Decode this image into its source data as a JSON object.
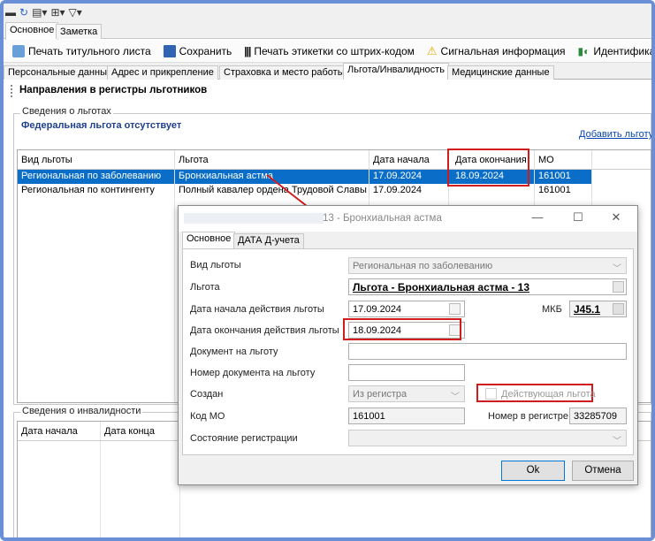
{
  "main_tabs": [
    "Основное",
    "Заметка"
  ],
  "toolbar": {
    "print_title": "Печать титульного листа",
    "save": "Сохранить",
    "print_labels": "Печать этикетки со штрих-кодом",
    "signal_info": "Сигнальная информация",
    "identification": "Идентификация"
  },
  "sub_tabs": [
    "Персональные данные",
    "Адрес и прикрепление",
    "Страховка и место работы",
    "Льгота/Инвалидность",
    "Медицинские данные"
  ],
  "section_title": "Направления в регистры льготников",
  "benefits_group": {
    "label": "Сведения о льготах",
    "federal_status": "Федеральная льгота отсутствует",
    "add_link": "Добавить льготу"
  },
  "benefits_table": {
    "headers": [
      "Вид льготы",
      "Льгота",
      "Дата начала",
      "Дата окончания",
      "МО"
    ],
    "rows": [
      [
        "Региональная по заболеванию",
        "Бронхиальная астма",
        "17.09.2024",
        "18.09.2024",
        "161001"
      ],
      [
        "Региональная по контингенту",
        "Полный кавалер ордена Трудовой Славы",
        "17.09.2024",
        "",
        "161001"
      ]
    ]
  },
  "disability_group": {
    "label": "Сведения о инвалидности",
    "headers": [
      "Дата начала",
      "Дата конца"
    ]
  },
  "dialog": {
    "title": "13 - Бронхиальная астма",
    "tabs": [
      "Основное",
      "ДАТА Д-учета"
    ],
    "fields": {
      "benefit_type_label": "Вид льготы",
      "benefit_type_value": "Региональная по заболеванию",
      "benefit_label": "Льгота",
      "benefit_value": "Льгота - Бронхиальная астма - 13",
      "start_label": "Дата начала действия льготы",
      "start_value": "17.09.2024",
      "mkb_label": "МКБ",
      "mkb_value": "J45.1",
      "end_label": "Дата окончания действия льготы",
      "end_value": "18.09.2024",
      "doc_label": "Документ на льготу",
      "doc_value": "",
      "doc_number_label": "Номер документа на льготу",
      "doc_number_value": "",
      "created_label": "Создан",
      "created_value": "Из регистра",
      "active_label": "Действующая льгота",
      "mo_code_label": "Код МО",
      "mo_code_value": "161001",
      "register_number_label": "Номер в регистре",
      "register_number_value": "33285709",
      "reg_state_label": "Состояние регистрации",
      "reg_state_value": ""
    },
    "ok": "Ok",
    "cancel": "Отмена"
  },
  "colors": {
    "selection": "#0a6ec8",
    "highlight": "#d01c1c",
    "link": "#0645ad"
  }
}
